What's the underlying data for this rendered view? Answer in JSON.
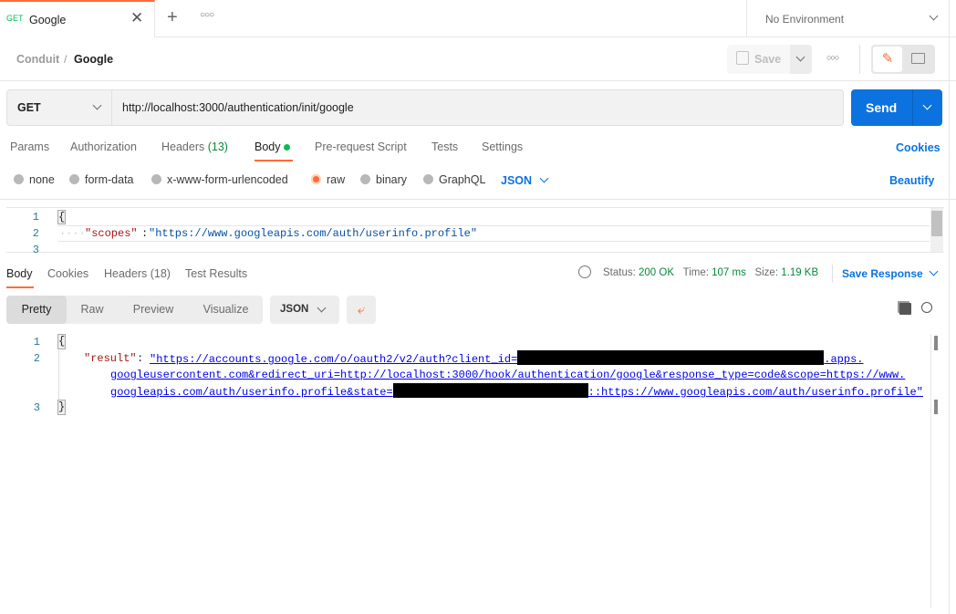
{
  "tabbar": {
    "method": "GET",
    "tab_title": "Google",
    "environment": "No Environment"
  },
  "breadcrumb": {
    "collection": "Conduit",
    "separator": "/",
    "request": "Google"
  },
  "toolbar": {
    "save_label": "Save"
  },
  "request": {
    "method": "GET",
    "url": "http://localhost:3000/authentication/init/google",
    "send_label": "Send"
  },
  "request_tabs": [
    {
      "label": "Params"
    },
    {
      "label": "Authorization"
    },
    {
      "label": "Headers",
      "count": "(13)"
    },
    {
      "label": "Body",
      "active": true
    },
    {
      "label": "Pre-request Script"
    },
    {
      "label": "Tests"
    },
    {
      "label": "Settings"
    }
  ],
  "cookies_label": "Cookies",
  "body_options": {
    "none": "none",
    "form_data": "form-data",
    "urlencoded": "x-www-form-urlencoded",
    "raw": "raw",
    "binary": "binary",
    "graphql": "GraphQL",
    "format": "JSON",
    "beautify": "Beautify",
    "selected": "raw"
  },
  "request_body": {
    "lines": [
      "{",
      "\"scopes\":\"https://www.googleapis.com/auth/userinfo.profile\"",
      ""
    ],
    "key": "\"scopes\"",
    "value": "\"https://www.googleapis.com/auth/userinfo.profile\""
  },
  "response_tabs": [
    {
      "label": "Body",
      "active": true
    },
    {
      "label": "Cookies"
    },
    {
      "label": "Headers",
      "count": "(18)"
    },
    {
      "label": "Test Results"
    }
  ],
  "status": {
    "status_label": "Status:",
    "status": "200 OK",
    "time_label": "Time:",
    "time": "107 ms",
    "size_label": "Size:",
    "size": "1.19 KB",
    "save_response": "Save Response",
    "color": "#0a8a3a"
  },
  "view_modes": {
    "pretty": "Pretty",
    "raw": "Raw",
    "preview": "Preview",
    "visualize": "Visualize",
    "format": "JSON",
    "active": "Pretty"
  },
  "response_body": {
    "line1": "{",
    "key": "\"result\"",
    "url_part1": "\"https://accounts.google.com/o/oauth2/v2/auth?client_id=",
    "url_part2": ".apps.",
    "url_part3": "googleusercontent.com&redirect_uri=http://localhost:3000/hook/authentication/google&response_type=code&scope=https://www.",
    "url_part4": "googleapis.com/auth/userinfo.profile&state=",
    "url_part5": "::https://www.googleapis.com/auth/userinfo.profile\"",
    "line3": "}"
  },
  "colors": {
    "accent": "#ff6c37",
    "primary": "#0c72e0",
    "success": "#0a8a3a"
  }
}
